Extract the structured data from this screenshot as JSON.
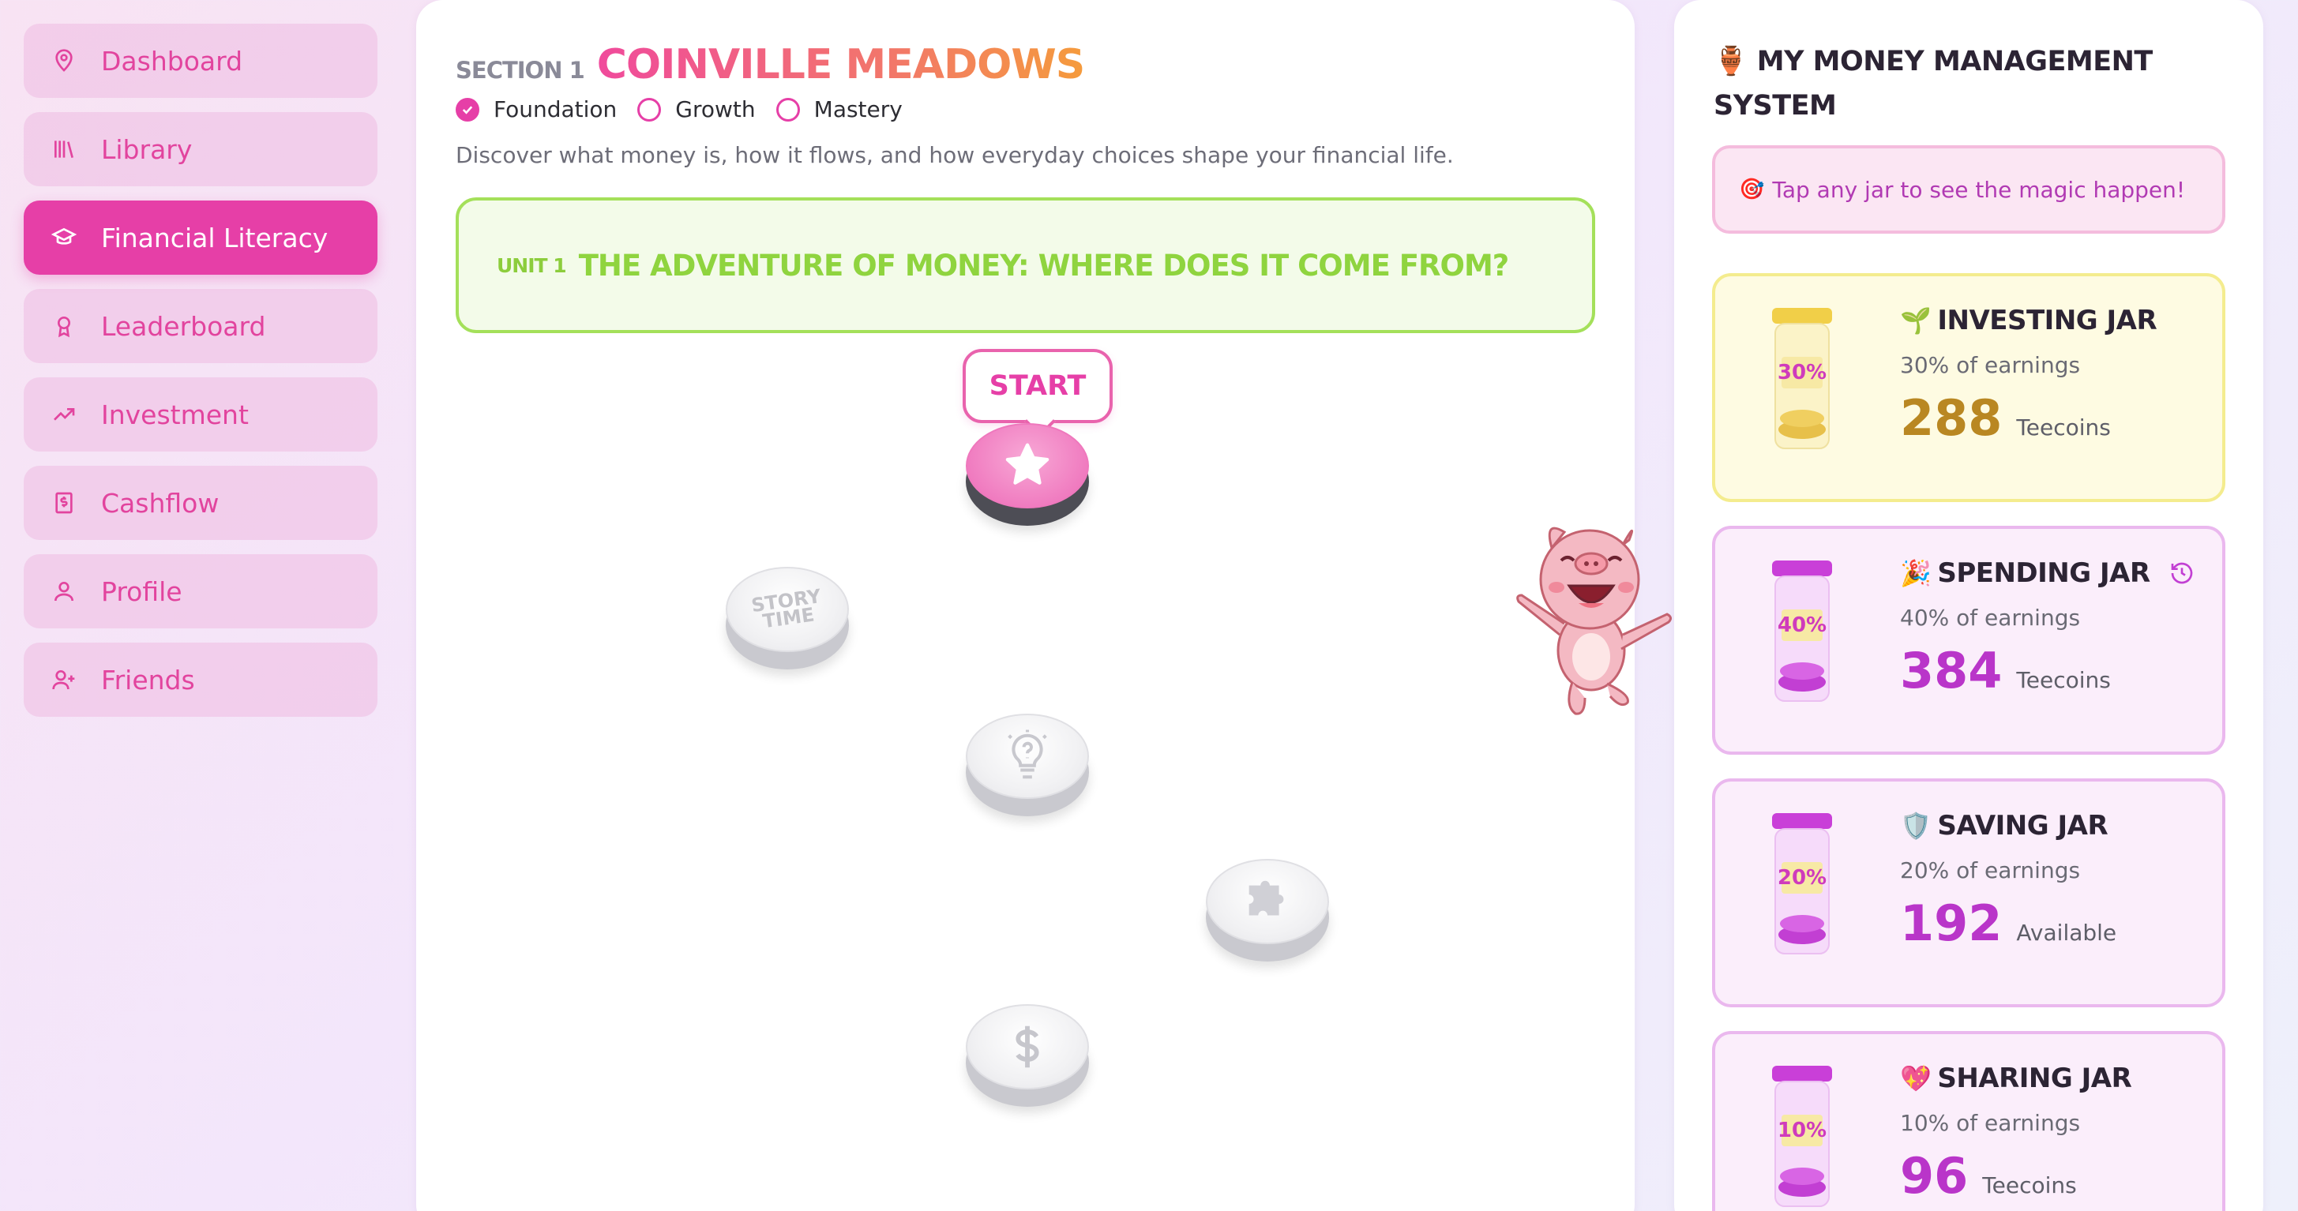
{
  "sidebar": {
    "items": [
      {
        "label": "Dashboard",
        "icon": "map-pin-icon",
        "active": false
      },
      {
        "label": "Library",
        "icon": "library-icon",
        "active": false
      },
      {
        "label": "Financial Literacy",
        "icon": "graduation-cap-icon",
        "active": true
      },
      {
        "label": "Leaderboard",
        "icon": "award-icon",
        "active": false
      },
      {
        "label": "Investment",
        "icon": "trending-up-icon",
        "active": false
      },
      {
        "label": "Cashflow",
        "icon": "receipt-icon",
        "active": false
      },
      {
        "label": "Profile",
        "icon": "user-icon",
        "active": false
      },
      {
        "label": "Friends",
        "icon": "user-plus-icon",
        "active": false
      }
    ]
  },
  "section": {
    "label": "SECTION 1",
    "title": "COINVILLE MEADOWS",
    "levels": [
      {
        "label": "Foundation",
        "checked": true
      },
      {
        "label": "Growth",
        "checked": false
      },
      {
        "label": "Mastery",
        "checked": false
      }
    ],
    "description": "Discover what money is, how it flows, and how everyday choices shape your financial life."
  },
  "unit": {
    "label": "UNIT 1",
    "title": "THE ADVENTURE OF MONEY: WHERE DOES IT COME FROM?"
  },
  "path": {
    "start_label": "START",
    "story_text": "STORY TIME",
    "nodes": [
      {
        "icon": "star-icon",
        "state": "active"
      },
      {
        "icon": "story-time-icon",
        "state": "locked"
      },
      {
        "icon": "lightbulb-question-icon",
        "state": "locked"
      },
      {
        "icon": "puzzle-icon",
        "state": "locked"
      },
      {
        "icon": "dollar-icon",
        "state": "locked"
      }
    ],
    "mascot": "pig-mascot"
  },
  "money_panel": {
    "title": "MY MONEY MANAGEMENT SYSTEM",
    "title_icon": "jar-icon",
    "tip": "Tap any jar to see the magic happen!",
    "tip_icon": "target-icon",
    "jars": [
      {
        "name": "INVESTING JAR",
        "emoji": "🌱",
        "pct_label": "30%",
        "percent_text": "30% of earnings",
        "amount": "288",
        "unit": "Teecoins",
        "color": "#e9c23c"
      },
      {
        "name": "SPENDING JAR",
        "emoji": "🎉",
        "pct_label": "40%",
        "percent_text": "40% of earnings",
        "amount": "384",
        "unit": "Teecoins",
        "color": "#cf4fe0",
        "has_history": true
      },
      {
        "name": "SAVING JAR",
        "emoji": "🛡️",
        "pct_label": "20%",
        "percent_text": "20% of earnings",
        "amount": "192",
        "unit": "Available",
        "color": "#cf4fe0"
      },
      {
        "name": "SHARING JAR",
        "emoji": "💖",
        "pct_label": "10%",
        "percent_text": "10% of earnings",
        "amount": "96",
        "unit": "Teecoins",
        "color": "#cf4fe0"
      }
    ]
  }
}
